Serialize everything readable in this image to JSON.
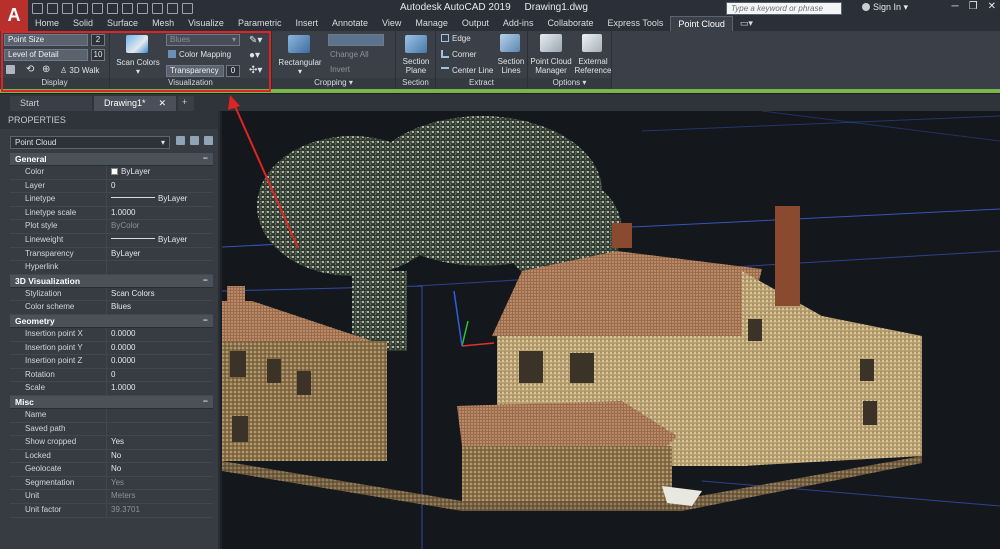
{
  "title_bar": {
    "app_logo": "A",
    "app_title": "Autodesk AutoCAD 2019",
    "file_name": "Drawing1.dwg",
    "search_placeholder": "Type a keyword or phrase",
    "sign_in": "Sign In"
  },
  "ribbon_tabs": [
    "Home",
    "Solid",
    "Surface",
    "Mesh",
    "Visualize",
    "Parametric",
    "Insert",
    "Annotate",
    "View",
    "Manage",
    "Output",
    "Add-ins",
    "Collaborate",
    "Express Tools",
    "Point Cloud"
  ],
  "ribbon": {
    "display": {
      "title": "Display",
      "point_size_label": "Point Size",
      "point_size_value": "2",
      "level_of_detail_label": "Level of Detail",
      "level_of_detail_value": "10",
      "walk_label": "3D Walk"
    },
    "visualization": {
      "title": "Visualization",
      "scan_colors_label": "Scan Colors",
      "color_scheme_value": "Blues",
      "color_mapping_label": "Color Mapping",
      "transparency_label": "Transparency",
      "transparency_value": "0"
    },
    "cropping": {
      "title": "Cropping",
      "rectangular_label": "Rectangular",
      "change_all_label": "Change All",
      "invert_label": "Invert"
    },
    "section": {
      "title": "Section",
      "section_plane_label": "Section Plane"
    },
    "extract": {
      "title": "Extract",
      "edge_label": "Edge",
      "corner_label": "Corner",
      "center_line_label": "Center Line",
      "section_lines_label": "Section Lines"
    },
    "options": {
      "title": "Options",
      "manager_label": "Point Cloud Manager",
      "external_reference_label": "External Reference"
    }
  },
  "file_tabs": [
    "Start",
    "Drawing1*"
  ],
  "properties": {
    "header": "PROPERTIES",
    "object_type": "Point Cloud",
    "sections": [
      {
        "name": "General",
        "rows": [
          {
            "key": "Color",
            "value": "ByLayer",
            "swatch": "box"
          },
          {
            "key": "Layer",
            "value": "0"
          },
          {
            "key": "Linetype",
            "value": "ByLayer",
            "swatch": "line"
          },
          {
            "key": "Linetype scale",
            "value": "1.0000"
          },
          {
            "key": "Plot style",
            "value": "ByColor",
            "dim": true
          },
          {
            "key": "Lineweight",
            "value": "ByLayer",
            "swatch": "line"
          },
          {
            "key": "Transparency",
            "value": "ByLayer"
          },
          {
            "key": "Hyperlink",
            "value": ""
          }
        ]
      },
      {
        "name": "3D Visualization",
        "rows": [
          {
            "key": "Stylization",
            "value": "Scan Colors"
          },
          {
            "key": "Color scheme",
            "value": "Blues"
          }
        ]
      },
      {
        "name": "Geometry",
        "rows": [
          {
            "key": "Insertion point X",
            "value": "0.0000"
          },
          {
            "key": "Insertion point Y",
            "value": "0.0000"
          },
          {
            "key": "Insertion point Z",
            "value": "0.0000"
          },
          {
            "key": "Rotation",
            "value": "0"
          },
          {
            "key": "Scale",
            "value": "1.0000"
          }
        ]
      },
      {
        "name": "Misc",
        "rows": [
          {
            "key": "Name",
            "value": ""
          },
          {
            "key": "Saved path",
            "value": ""
          },
          {
            "key": "Show cropped",
            "value": "Yes"
          },
          {
            "key": "Locked",
            "value": "No"
          },
          {
            "key": "Geolocate",
            "value": "No"
          },
          {
            "key": "Segmentation",
            "value": "Yes",
            "dim": true
          },
          {
            "key": "Unit",
            "value": "Meters",
            "dim": true
          },
          {
            "key": "Unit factor",
            "value": "39.3701",
            "dim": true
          }
        ]
      }
    ]
  },
  "colors": {
    "accent_green": "#7ab648",
    "highlight_red": "#e02424",
    "selection_blue": "#4a6cff"
  }
}
